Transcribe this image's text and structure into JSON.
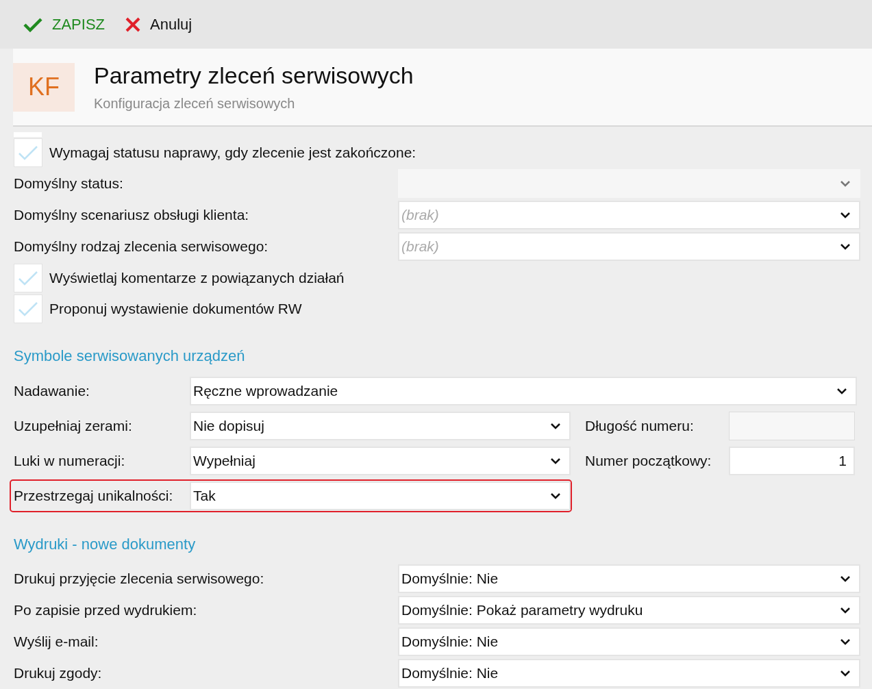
{
  "toolbar": {
    "buttons": [
      {
        "kind": "save",
        "label": "ZAPISZ"
      },
      {
        "kind": "cancel",
        "label": "Anuluj"
      }
    ]
  },
  "header": {
    "badge": "KF",
    "title": "Parametry zleceń serwisowych",
    "subtitle": "Konfiguracja zleceń serwisowych"
  },
  "general": [
    {
      "kind": "checkbox",
      "label": "Wymagaj statusu naprawy, gdy zlecenie jest zakończone:",
      "checked": false
    },
    {
      "kind": "select",
      "label": "Domyślny status:",
      "disabled": true
    },
    {
      "kind": "select",
      "label": "Domyślny scenariusz obsługi klienta:",
      "placeholder": "(brak)",
      "disabled": false
    },
    {
      "kind": "select",
      "label": "Domyślny rodzaj zlecenia serwisowego:",
      "placeholder": "(brak)",
      "disabled": false
    },
    {
      "kind": "checkbox",
      "label": "Wyświetlaj komentarze z powiązanych działań",
      "checked": false
    },
    {
      "kind": "checkbox",
      "label": "Proponuj wystawienie dokumentów RW",
      "checked": false
    }
  ],
  "symbols": {
    "title": "Symbole serwisowanych urządzeń",
    "rows": [
      {
        "kind": "wide",
        "label": "Nadawanie:",
        "value": "Ręczne wprowadzanie",
        "highlighted": false
      },
      {
        "label": "Uzupełniaj zerami:",
        "value": "Nie dopisuj",
        "highlighted": false,
        "side": {
          "label": "Długość numeru:",
          "disabled": true
        }
      },
      {
        "label": "Luki w numeracji:",
        "value": "Wypełniaj",
        "highlighted": false,
        "side": {
          "label": "Numer początkowy:",
          "value": "1",
          "disabled": false
        }
      },
      {
        "label": "Przestrzegaj unikalności:",
        "value": "Tak",
        "highlighted": true
      }
    ]
  },
  "prints": {
    "title": "Wydruki - nowe dokumenty",
    "rows": [
      {
        "label": "Drukuj przyjęcie zlecenia serwisowego:",
        "value": "Domyślnie: Nie"
      },
      {
        "label": "Po zapisie przed wydrukiem:",
        "value": "Domyślnie: Pokaż parametry wydruku"
      },
      {
        "label": "Wyślij e-mail:",
        "value": "Domyślnie: Nie"
      },
      {
        "label": "Drukuj zgody:",
        "value": "Domyślnie: Nie"
      }
    ]
  }
}
